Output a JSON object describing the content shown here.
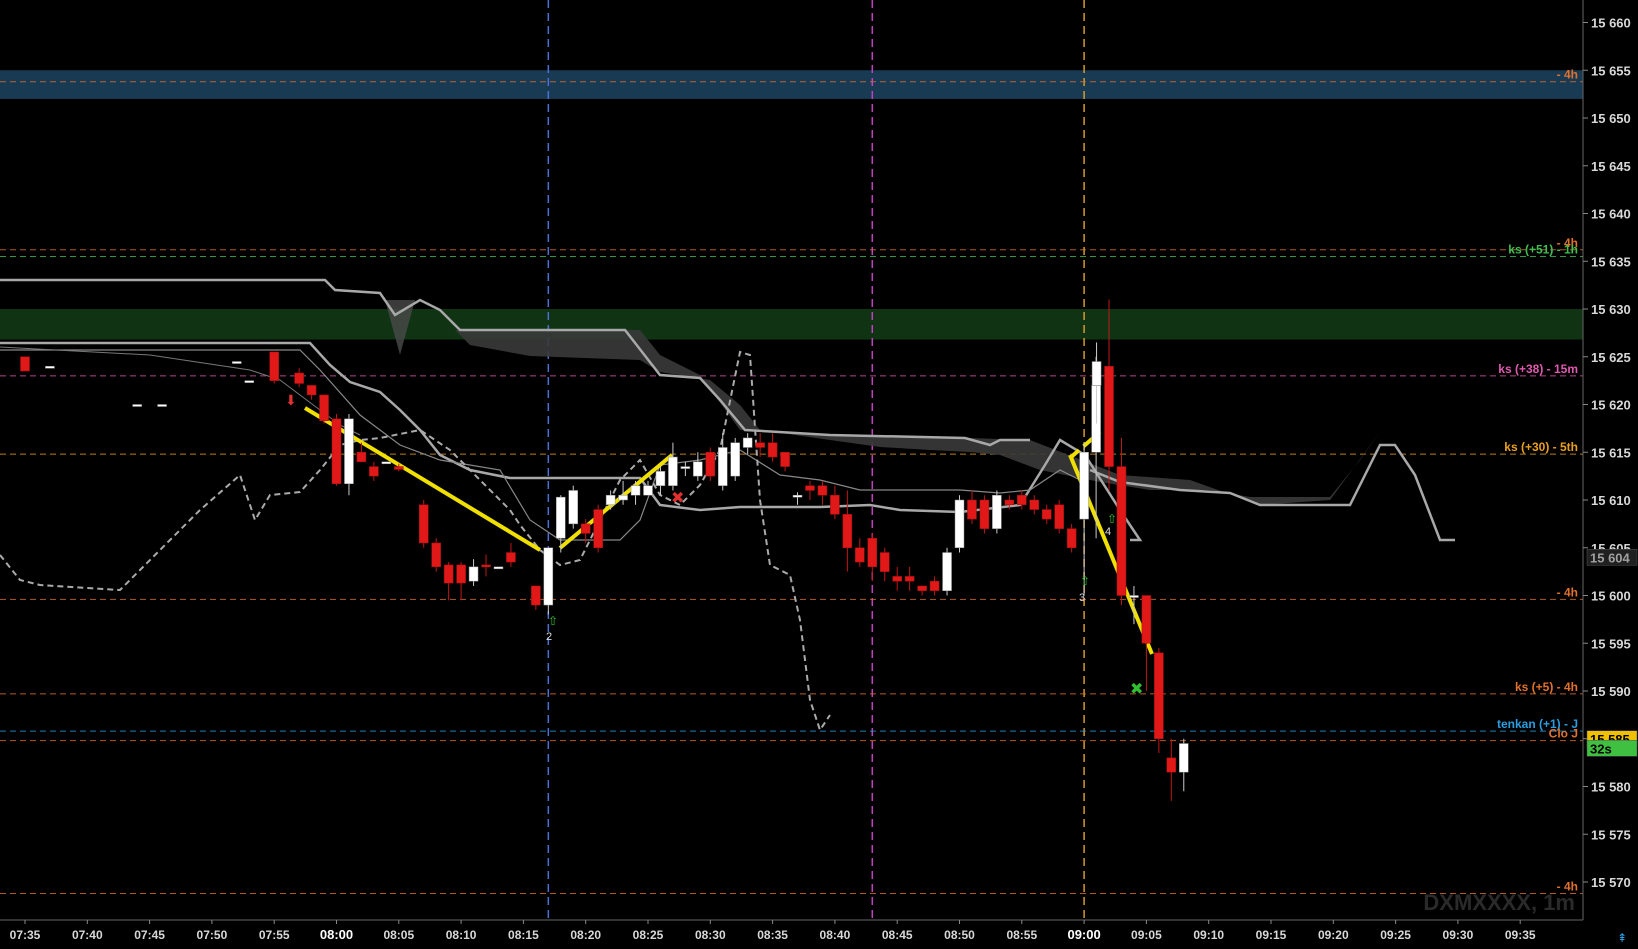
{
  "chart_data": {
    "type": "candlestick",
    "symbol": "DXMXXXX, 1m",
    "y_axis": {
      "min": 15567,
      "max": 15662,
      "ticks": [
        15570,
        15575,
        15580,
        15585,
        15590,
        15595,
        15600,
        15605,
        15610,
        15615,
        15620,
        15625,
        15630,
        15635,
        15640,
        15645,
        15650,
        15655,
        15660
      ],
      "tick_labels": [
        "15 570",
        "15 575",
        "15 580",
        "15 585",
        "15 590",
        "15 595",
        "15 600",
        "15 605",
        "15 610",
        "15 615",
        "15 620",
        "15 625",
        "15 630",
        "15 635",
        "15 640",
        "15 645",
        "15 650",
        "15 655",
        "15 660"
      ]
    },
    "x_axis": {
      "start": "07:35",
      "end": "09:35",
      "tick_labels": [
        "07:35",
        "07:40",
        "07:45",
        "07:50",
        "07:55",
        "08:00",
        "08:05",
        "08:10",
        "08:15",
        "08:20",
        "08:25",
        "08:30",
        "08:35",
        "08:40",
        "08:45",
        "08:50",
        "08:55",
        "09:00",
        "09:05",
        "09:10",
        "09:15",
        "09:20",
        "09:25",
        "09:30",
        "09:35"
      ],
      "bold_labels": [
        "08:00",
        "09:00"
      ]
    },
    "vertical_markers": [
      {
        "time": "08:17",
        "color": "#4a6fd6"
      },
      {
        "time": "08:43",
        "color": "#c040c0"
      },
      {
        "time": "09:00",
        "color": "#d49a2a"
      }
    ],
    "zones": [
      {
        "from": 15652.0,
        "to": 15655.0,
        "color": "#183a52"
      },
      {
        "from": 15626.8,
        "to": 15630.0,
        "color": "#0f3313"
      }
    ],
    "levels": [
      {
        "price": 15653.8,
        "label": "- 4h",
        "color": "#e0712e"
      },
      {
        "price": 15636.2,
        "label": "- 4h",
        "color": "#e0712e"
      },
      {
        "price": 15635.5,
        "label": "ks (+51) - 1h",
        "color": "#3fbf4f"
      },
      {
        "price": 15623.0,
        "label": "ks (+38) - 15m",
        "color": "#e05ab0"
      },
      {
        "price": 15614.8,
        "label": "ks (+30) - 5th",
        "color": "#e8a020"
      },
      {
        "price": 15599.6,
        "label": "- 4h",
        "color": "#e0712e"
      },
      {
        "price": 15589.7,
        "label": "ks (+5) - 4h",
        "color": "#e0712e"
      },
      {
        "price": 15585.8,
        "label": "tenkan (+1) - J",
        "color": "#2a9ee0"
      },
      {
        "price": 15584.8,
        "label": "Clo J",
        "color": "#e0712e"
      },
      {
        "price": 15568.8,
        "label": "- 4h",
        "color": "#e0712e"
      }
    ],
    "price_tags": [
      {
        "price": 15585.0,
        "label": "15 585",
        "bg": "#f0c000",
        "color": "#000000"
      },
      {
        "price": 15584.0,
        "label": "32s",
        "bg": "#40c040",
        "color": "#000000"
      },
      {
        "price": 15604.0,
        "label": "15 604",
        "bg": "#202020",
        "color": "#a0a0a0"
      }
    ],
    "candles": [
      {
        "t": "07:35",
        "o": 15625,
        "h": 15625,
        "c": 15623.5,
        "l": 15623.5
      },
      {
        "t": "07:37",
        "o": 15624,
        "h": 15624,
        "c": 15624,
        "l": 15624
      },
      {
        "t": "07:44",
        "o": 15620,
        "h": 15620,
        "c": 15620,
        "l": 15620
      },
      {
        "t": "07:46",
        "o": 15620,
        "h": 15620,
        "c": 15620,
        "l": 15620
      },
      {
        "t": "07:52",
        "o": 15624.5,
        "h": 15624.5,
        "c": 15624.5,
        "l": 15624.5
      },
      {
        "t": "07:53",
        "o": 15622.5,
        "h": 15622.5,
        "c": 15622.5,
        "l": 15622.5
      },
      {
        "t": "07:55",
        "o": 15625.5,
        "h": 15625.5,
        "c": 15622.5,
        "l": 15622.2
      },
      {
        "t": "07:57",
        "o": 15623.3,
        "h": 15623.8,
        "c": 15622.2,
        "l": 15621.8
      },
      {
        "t": "07:58",
        "o": 15622,
        "h": 15622,
        "c": 15621,
        "l": 15620.5
      },
      {
        "t": "07:59",
        "o": 15621,
        "h": 15621,
        "c": 15618.3,
        "l": 15618
      },
      {
        "t": "08:00",
        "o": 15618.5,
        "h": 15619,
        "c": 15611.7,
        "l": 15611.5
      },
      {
        "t": "08:01",
        "o": 15611.7,
        "h": 15619,
        "c": 15618.5,
        "l": 15610.5
      },
      {
        "t": "08:02",
        "o": 15615,
        "h": 15616,
        "c": 15614,
        "l": 15614
      },
      {
        "t": "08:03",
        "o": 15613.5,
        "h": 15614,
        "c": 15612.5,
        "l": 15612
      },
      {
        "t": "08:04",
        "o": 15614,
        "h": 15614,
        "c": 15614,
        "l": 15614
      },
      {
        "t": "08:05",
        "o": 15613.5,
        "h": 15613.8,
        "c": 15613.2,
        "l": 15613
      },
      {
        "t": "08:07",
        "o": 15609.5,
        "h": 15610,
        "c": 15605.5,
        "l": 15605
      },
      {
        "t": "08:08",
        "o": 15605.5,
        "h": 15606,
        "c": 15603,
        "l": 15602.5
      },
      {
        "t": "08:09",
        "o": 15603.2,
        "h": 15603.5,
        "c": 15601.3,
        "l": 15599.5
      },
      {
        "t": "08:10",
        "o": 15603.2,
        "h": 15603.5,
        "c": 15601.3,
        "l": 15599.5
      },
      {
        "t": "08:11",
        "o": 15601.5,
        "h": 15603.8,
        "c": 15603,
        "l": 15601
      },
      {
        "t": "08:12",
        "o": 15603.2,
        "h": 15604.3,
        "c": 15603,
        "l": 15602
      },
      {
        "t": "08:13",
        "o": 15603,
        "h": 15603,
        "c": 15603,
        "l": 15603
      },
      {
        "t": "08:14",
        "o": 15604.5,
        "h": 15605.5,
        "c": 15603.5,
        "l": 15603
      },
      {
        "t": "08:16",
        "o": 15601,
        "h": 15601,
        "c": 15599,
        "l": 15598.5
      },
      {
        "t": "08:17",
        "o": 15599,
        "h": 15605,
        "c": 15605,
        "l": 15598
      },
      {
        "t": "08:18",
        "o": 15606,
        "h": 15610.5,
        "c": 15610.3,
        "l": 15604.5
      },
      {
        "t": "08:19",
        "o": 15607.5,
        "h": 15611.5,
        "c": 15611,
        "l": 15607
      },
      {
        "t": "08:20",
        "o": 15607.5,
        "h": 15608,
        "c": 15606.5,
        "l": 15605.5
      },
      {
        "t": "08:21",
        "o": 15609,
        "h": 15609.5,
        "c": 15605,
        "l": 15604.5
      },
      {
        "t": "08:22",
        "o": 15609.5,
        "h": 15611,
        "c": 15610.5,
        "l": 15609
      },
      {
        "t": "08:23",
        "o": 15610,
        "h": 15612,
        "c": 15610.5,
        "l": 15609.5
      },
      {
        "t": "08:24",
        "o": 15610.5,
        "h": 15612,
        "c": 15611.5,
        "l": 15609.5
      },
      {
        "t": "08:25",
        "o": 15610.5,
        "h": 15612,
        "c": 15611.5,
        "l": 15610.5
      },
      {
        "t": "08:26",
        "o": 15611.5,
        "h": 15613.5,
        "c": 15613,
        "l": 15610.5
      },
      {
        "t": "08:27",
        "o": 15611.5,
        "h": 15616,
        "c": 15614.5,
        "l": 15611
      },
      {
        "t": "08:28",
        "o": 15613.5,
        "h": 15614,
        "c": 15613.5,
        "l": 15612.5
      },
      {
        "t": "08:29",
        "o": 15612.5,
        "h": 15615,
        "c": 15614,
        "l": 15612
      },
      {
        "t": "08:30",
        "o": 15615,
        "h": 15615.5,
        "c": 15612.5,
        "l": 15612
      },
      {
        "t": "08:31",
        "o": 15611.5,
        "h": 15617,
        "c": 15615.5,
        "l": 15611
      },
      {
        "t": "08:32",
        "o": 15612.5,
        "h": 15616.5,
        "c": 15616,
        "l": 15612
      },
      {
        "t": "08:33",
        "o": 15615.5,
        "h": 15617,
        "c": 15616.5,
        "l": 15614.8
      },
      {
        "t": "08:34",
        "o": 15616,
        "h": 15617,
        "c": 15615.5,
        "l": 15614.5
      },
      {
        "t": "08:35",
        "o": 15616,
        "h": 15617,
        "c": 15614.5,
        "l": 15614
      },
      {
        "t": "08:36",
        "o": 15615,
        "h": 15615,
        "c": 15613.5,
        "l": 15613
      },
      {
        "t": "08:37",
        "o": 15610.5,
        "h": 15610.8,
        "c": 15610.5,
        "l": 15609.5
      },
      {
        "t": "08:38",
        "o": 15611.5,
        "h": 15612,
        "c": 15611,
        "l": 15610
      },
      {
        "t": "08:39",
        "o": 15611.5,
        "h": 15612,
        "c": 15610.5,
        "l": 15609.5
      },
      {
        "t": "08:40",
        "o": 15610.5,
        "h": 15611.5,
        "c": 15608.5,
        "l": 15608
      },
      {
        "t": "08:41",
        "o": 15608.5,
        "h": 15611,
        "c": 15605,
        "l": 15602.5
      },
      {
        "t": "08:42",
        "o": 15605,
        "h": 15606,
        "c": 15603.5,
        "l": 15603
      },
      {
        "t": "08:43",
        "o": 15606,
        "h": 15606.5,
        "c": 15603,
        "l": 15601.5
      },
      {
        "t": "08:44",
        "o": 15604.5,
        "h": 15605,
        "c": 15602.5,
        "l": 15601.5
      },
      {
        "t": "08:45",
        "o": 15602,
        "h": 15603,
        "c": 15601.5,
        "l": 15600.5
      },
      {
        "t": "08:46",
        "o": 15602,
        "h": 15603,
        "c": 15601.5,
        "l": 15600.5
      },
      {
        "t": "08:47",
        "o": 15601,
        "h": 15601,
        "c": 15600.5,
        "l": 15600
      },
      {
        "t": "08:48",
        "o": 15601.5,
        "h": 15602,
        "c": 15600.5,
        "l": 15600
      },
      {
        "t": "08:49",
        "o": 15600.5,
        "h": 15605,
        "c": 15604.5,
        "l": 15600
      },
      {
        "t": "08:50",
        "o": 15605,
        "h": 15610.5,
        "c": 15610,
        "l": 15604.5
      },
      {
        "t": "08:51",
        "o": 15610,
        "h": 15611,
        "c": 15608,
        "l": 15607.5
      },
      {
        "t": "08:52",
        "o": 15610,
        "h": 15610.5,
        "c": 15607,
        "l": 15606.5
      },
      {
        "t": "08:53",
        "o": 15607,
        "h": 15611,
        "c": 15610.5,
        "l": 15606.5
      },
      {
        "t": "08:54",
        "o": 15610,
        "h": 15610.5,
        "c": 15609.5,
        "l": 15609
      },
      {
        "t": "08:55",
        "o": 15610.5,
        "h": 15611,
        "c": 15609.5,
        "l": 15609
      },
      {
        "t": "08:56",
        "o": 15610,
        "h": 15610.5,
        "c": 15609,
        "l": 15608.5
      },
      {
        "t": "08:57",
        "o": 15609,
        "h": 15609.5,
        "c": 15608,
        "l": 15607.5
      },
      {
        "t": "08:58",
        "o": 15609.5,
        "h": 15610,
        "c": 15607,
        "l": 15606.5
      },
      {
        "t": "08:59",
        "o": 15607,
        "h": 15607.5,
        "c": 15605,
        "l": 15604.5
      },
      {
        "t": "09:00",
        "o": 15608,
        "h": 15616,
        "c": 15615,
        "l": 15600
      },
      {
        "t": "09:00b",
        "o": 15615,
        "h": 15625,
        "c": 15622,
        "l": 15606
      },
      {
        "t": "09:01",
        "o": 15622,
        "h": 15626.5,
        "c": 15624.5,
        "l": 15618
      },
      {
        "t": "09:02",
        "o": 15624,
        "h": 15631,
        "c": 15613.5,
        "l": 15611
      },
      {
        "t": "09:03",
        "o": 15613.5,
        "h": 15616.5,
        "c": 15600,
        "l": 15599
      },
      {
        "t": "09:04",
        "o": 15600,
        "h": 15601,
        "c": 15600,
        "l": 15597
      },
      {
        "t": "09:05",
        "o": 15600,
        "h": 15600,
        "c": 15595,
        "l": 15590
      },
      {
        "t": "09:06",
        "o": 15594,
        "h": 15594.5,
        "c": 15585,
        "l": 15583.5
      },
      {
        "t": "09:07",
        "o": 15583,
        "h": 15585,
        "c": 15581.5,
        "l": 15578.5
      },
      {
        "t": "09:08",
        "o": 15581.5,
        "h": 15585,
        "c": 15584.5,
        "l": 15579.5
      }
    ]
  }
}
